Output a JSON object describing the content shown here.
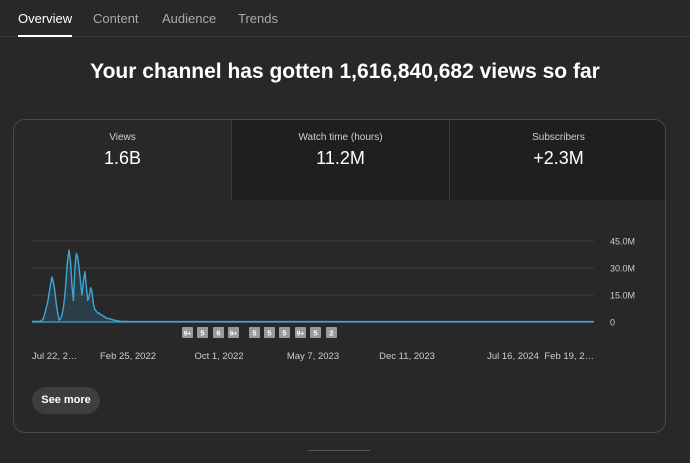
{
  "tabs": [
    {
      "label": "Overview",
      "active": true
    },
    {
      "label": "Content",
      "active": false
    },
    {
      "label": "Audience",
      "active": false
    },
    {
      "label": "Trends",
      "active": false
    }
  ],
  "headline": "Your channel has gotten 1,616,840,682 views so far",
  "metrics": [
    {
      "label": "Views",
      "value": "1.6B",
      "selected": true
    },
    {
      "label": "Watch time (hours)",
      "value": "11.2M",
      "selected": false
    },
    {
      "label": "Subscribers",
      "value": "+2.3M",
      "selected": false
    }
  ],
  "chart_data": {
    "type": "line",
    "series": [
      {
        "values": [
          0.3,
          0.3,
          0.3,
          0.3,
          0.3,
          0.4,
          0.5,
          1,
          2,
          5,
          8,
          11,
          16,
          21,
          25,
          22,
          17,
          10,
          5,
          1,
          2,
          4,
          8,
          15,
          25,
          35,
          40,
          33,
          20,
          12,
          30,
          38,
          36,
          30,
          22,
          15,
          23,
          28,
          20,
          12,
          14,
          19,
          17,
          10,
          7,
          6,
          5,
          5,
          4,
          4,
          3,
          3,
          2,
          2,
          2,
          1.5,
          1.5,
          1,
          1,
          0.8,
          0.6,
          0.5,
          0.4,
          0.3,
          0.3,
          0.3,
          0.3,
          0.3,
          0.2,
          0.2,
          0.2
        ]
      }
    ],
    "y_ticks": [
      "45.0M",
      "30.0M",
      "15.0M",
      "0"
    ],
    "y_tick_values": [
      45,
      30,
      15,
      0
    ],
    "ylim": [
      0,
      45
    ],
    "y_unit": "M",
    "x_ticks": [
      "Jul 22, 2…",
      "Feb 25, 2022",
      "Oct 1, 2022",
      "May 7, 2023",
      "Dec 11, 2023",
      "Jul 16, 2024",
      "Feb 19, 2…"
    ],
    "badges": [
      "9+",
      "5",
      "6",
      "9+",
      "5",
      "5",
      "5",
      "9+",
      "5",
      "2"
    ],
    "line_color": "#3ea6d6",
    "grid": true
  },
  "see_more_label": "See more"
}
